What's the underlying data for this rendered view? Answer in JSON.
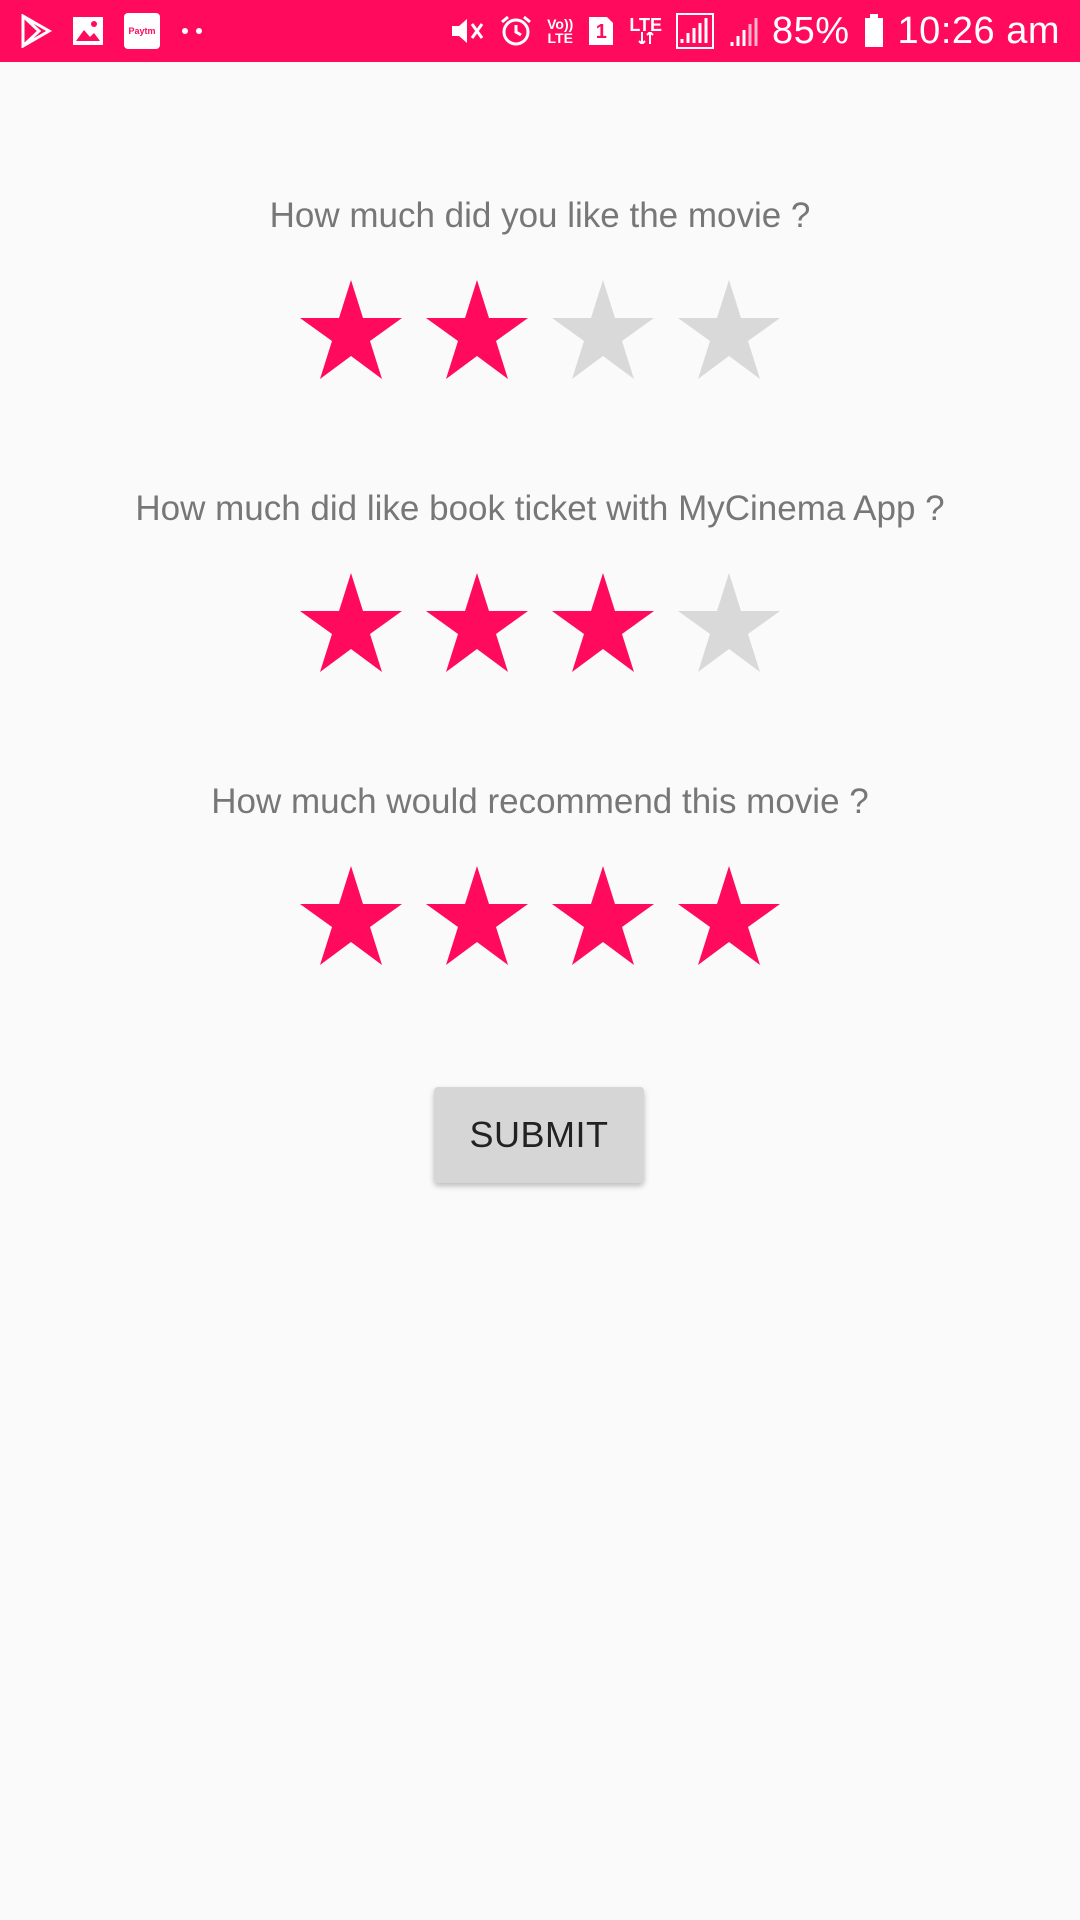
{
  "status_bar": {
    "background": "#ff0a5c",
    "left_icons": [
      "play-store-icon",
      "gallery-icon",
      "paytm-icon",
      "more-notifications-icon"
    ],
    "paytm_label": "Paytm",
    "volte_top": "Vo))",
    "volte_bottom": "LTE",
    "sim_number": "1",
    "lte_label": "LTE",
    "battery": "85%",
    "time": "10:26 am"
  },
  "colors": {
    "accent": "#ff0a5c",
    "star_filled": "#ff0a5c",
    "star_empty": "#d9d9d9",
    "question_text": "#777777",
    "button_bg": "#d6d6d6"
  },
  "questions": [
    {
      "label": "How much did you like the movie ?",
      "rating": 2,
      "max": 4
    },
    {
      "label": "How much did like book ticket with MyCinema App ?",
      "rating": 3,
      "max": 4
    },
    {
      "label": "How much would recommend this movie ?",
      "rating": 4,
      "max": 4
    }
  ],
  "submit_label": "SUBMIT"
}
